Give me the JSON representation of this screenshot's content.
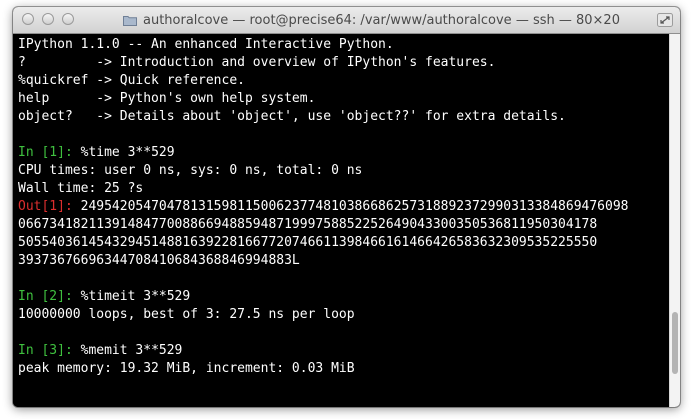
{
  "window": {
    "title": "authoralcove — root@precise64: /var/www/authoralcove — ssh — 80×20"
  },
  "terminal": {
    "banner": [
      "IPython 1.1.0 -- An enhanced Interactive Python.",
      "?         -> Introduction and overview of IPython's features.",
      "%quickref -> Quick reference.",
      "help      -> Python's own help system.",
      "object?   -> Details about 'object', use 'object??' for extra details."
    ],
    "in1_prompt": "In [1]: ",
    "in1_cmd": "%time 3**529",
    "cpu_times": "CPU times: user 0 ns, sys: 0 ns, total: 0 ns",
    "wall_time": "Wall time: 25 ?s",
    "out1_prompt": "Out[1]: ",
    "out1_lines": [
      "2495420547047813159811500623774810386686257318892372990313384869476098",
      "06673418211391484770088669488594871999758852252649043300350536811950304178",
      "50554036145432945148816392281667720746611398466161466426583632309535225550",
      "39373676696344708410684368846994883L"
    ],
    "in2_prompt": "In [2]: ",
    "in2_cmd": "%timeit 3**529",
    "timeit_result": "10000000 loops, best of 3: 27.5 ns per loop",
    "in3_prompt": "In [3]: ",
    "in3_cmd": "%memit 3**529",
    "memit_result": "peak memory: 19.32 MiB, increment: 0.03 MiB"
  },
  "colors": {
    "prompt_in": "#3fc03f",
    "prompt_out": "#dc2e2e",
    "terminal_bg": "#000000",
    "terminal_fg": "#ffffff"
  }
}
